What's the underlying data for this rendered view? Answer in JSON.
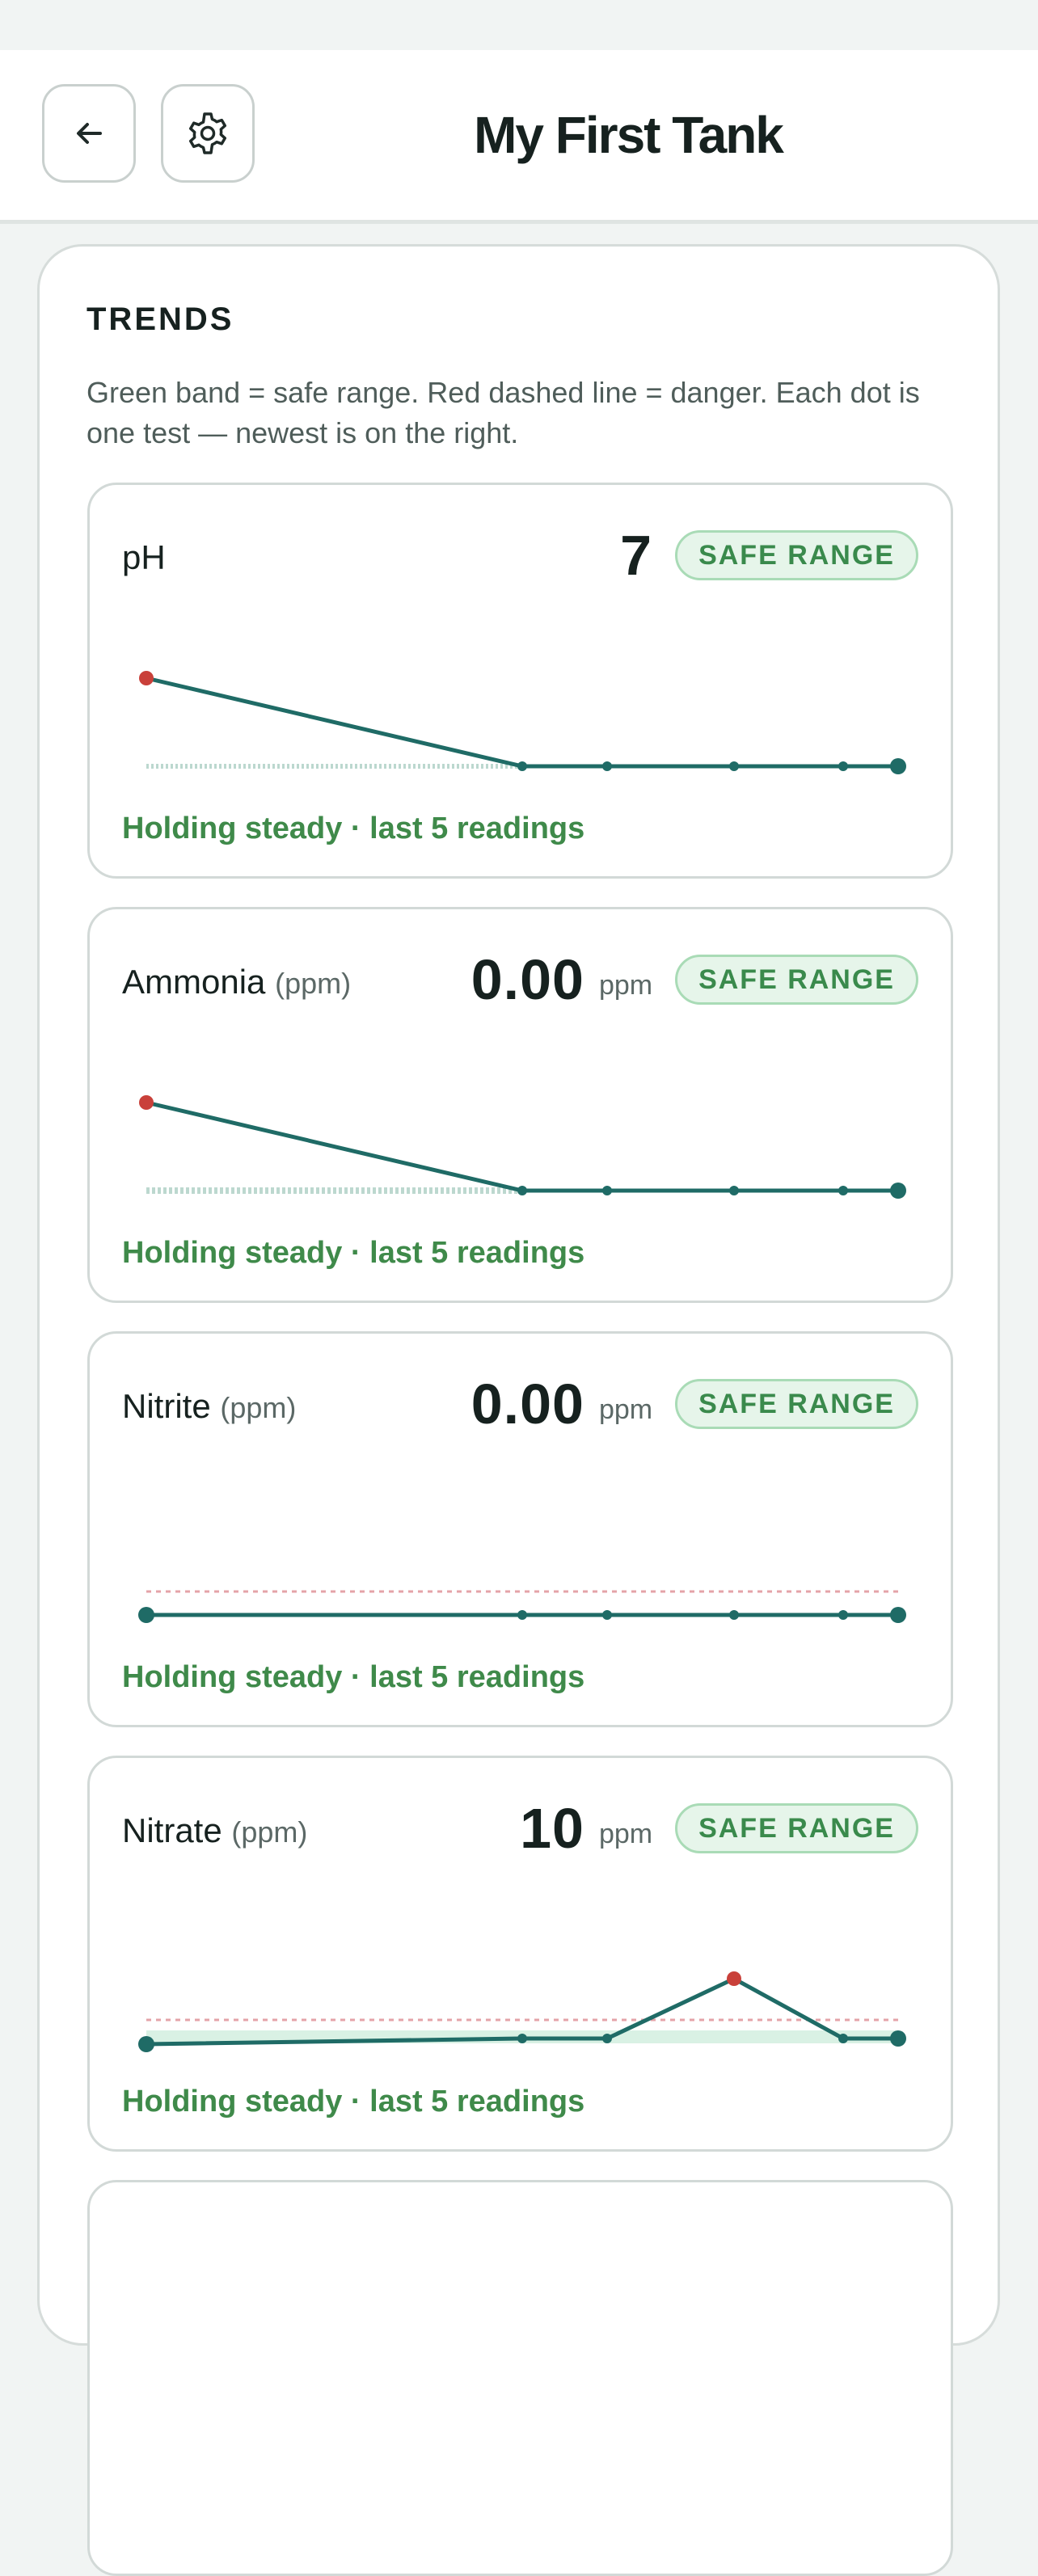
{
  "header": {
    "title": "My First Tank",
    "back_icon": "arrow-left-icon",
    "settings_icon": "gear-icon"
  },
  "trends": {
    "title": "TRENDS",
    "description": "Green band = safe range. Red dashed line = danger. Each dot is one test — newest is on the right.",
    "metrics": [
      {
        "name": "pH",
        "unit_label": "",
        "value": "7",
        "unit": "",
        "badge": "SAFE RANGE",
        "status": "Holding steady · last 5 readings"
      },
      {
        "name": "Ammonia",
        "unit_label": "(ppm)",
        "value": "0.00",
        "unit": "ppm",
        "badge": "SAFE RANGE",
        "status": "Holding steady · last 5 readings"
      },
      {
        "name": "Nitrite",
        "unit_label": "(ppm)",
        "value": "0.00",
        "unit": "ppm",
        "badge": "SAFE RANGE",
        "status": "Holding steady · last 5 readings"
      },
      {
        "name": "Nitrate",
        "unit_label": "(ppm)",
        "value": "10",
        "unit": "ppm",
        "badge": "SAFE RANGE",
        "status": "Holding steady · last 5 readings"
      }
    ]
  },
  "colors": {
    "line": "#1f6b66",
    "danger_point": "#c9403a",
    "danger_line": "#e4a3a8",
    "safe_band": "#cfeedd",
    "status_green": "#3f8a4a"
  }
}
